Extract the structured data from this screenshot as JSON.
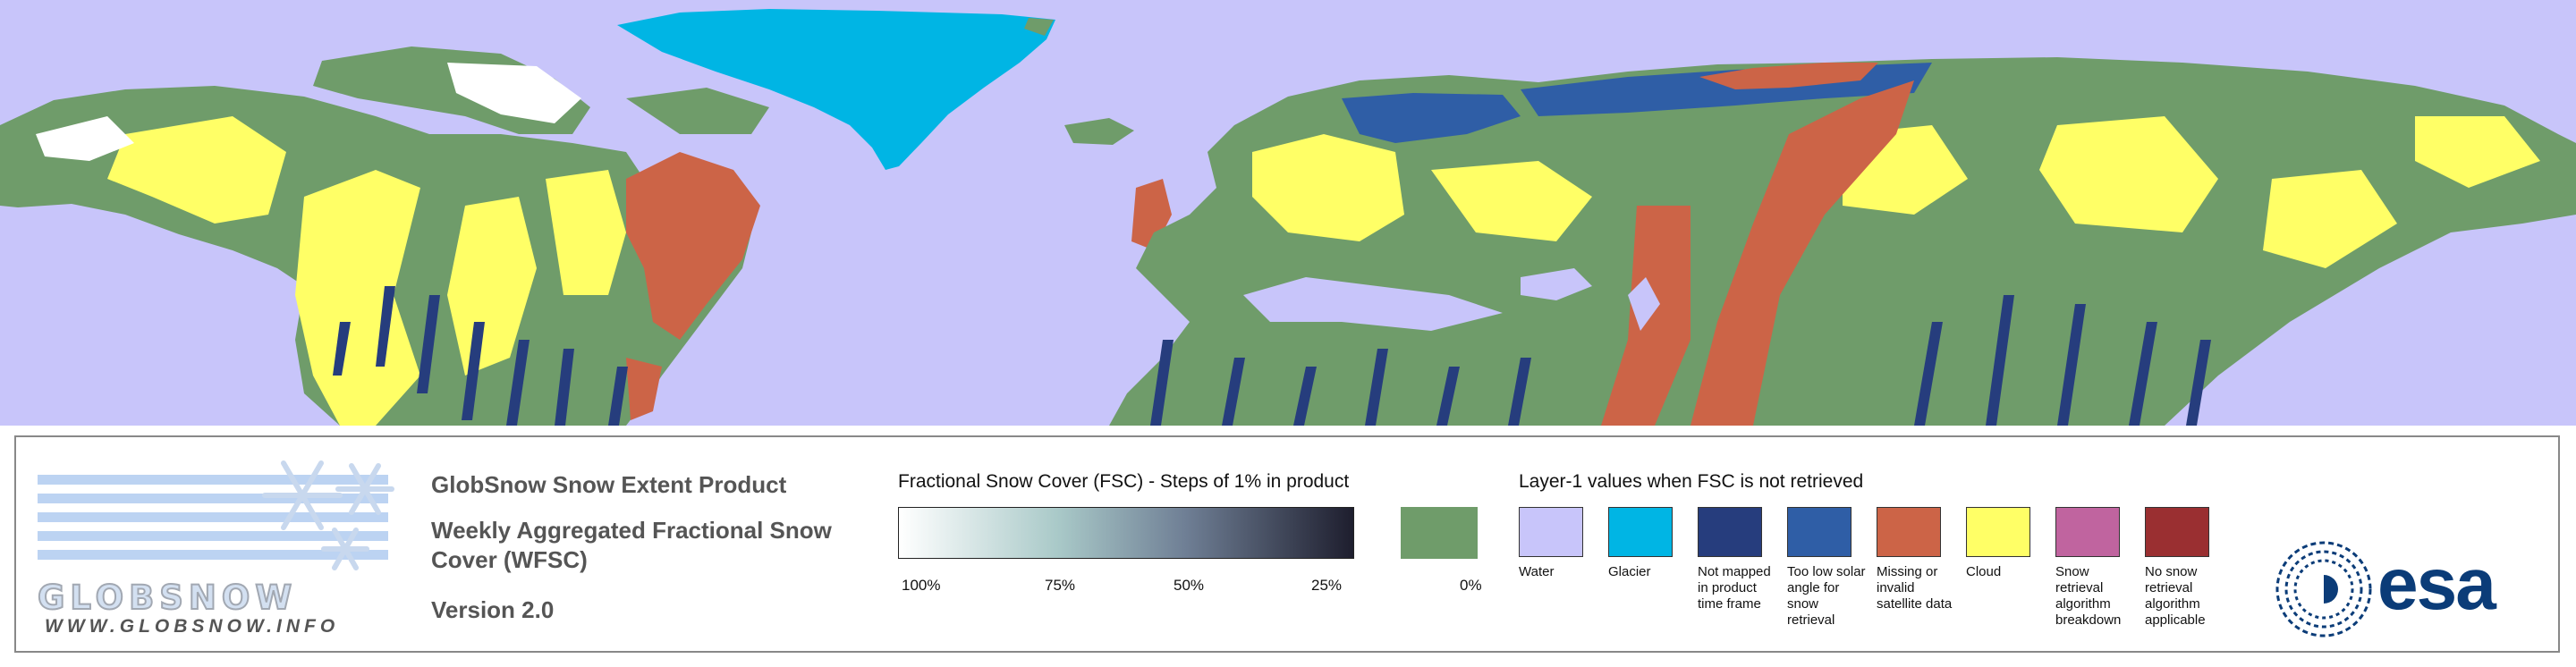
{
  "map": {
    "background_color": "#c8c5fa",
    "colors": {
      "water": "#c8c5fa",
      "glacier": "#00b5e4",
      "not_mapped": "#263d7d",
      "too_low_solar": "#2f5ea6",
      "missing": "#cc6447",
      "cloud": "#ffff66",
      "snow_free": "#6f9c6a"
    }
  },
  "logo": {
    "wordmark": "GLOBSNOW",
    "url": "WWW.GLOBSNOW.INFO"
  },
  "product": {
    "title": "GlobSnow Snow Extent Product",
    "subtitle": "Weekly Aggregated Fractional Snow Cover (WFSC)",
    "version": "Version 2.0"
  },
  "fsc_legend": {
    "title": "Fractional Snow Cover (FSC) - Steps of 1% in product",
    "ticks": [
      "100%",
      "75%",
      "50%",
      "25%",
      "0%"
    ]
  },
  "layer1_legend": {
    "title": "Layer-1 values when FSC is not retrieved",
    "items": [
      {
        "label": "Water",
        "color": "#c8c5fa"
      },
      {
        "label": "Glacier",
        "color": "#00b5e4"
      },
      {
        "label": "Not mapped in product time frame",
        "color": "#263d7d"
      },
      {
        "label": "Too low solar angle for snow retrieval",
        "color": "#2f5ea6"
      },
      {
        "label": "Missing or invalid satellite data",
        "color": "#cc6447"
      },
      {
        "label": "Cloud",
        "color": "#ffff66"
      },
      {
        "label": "Snow retrieval algorithm breakdown",
        "color": "#c0649f"
      },
      {
        "label": "No snow retrieval algorithm applicable",
        "color": "#9a2f31"
      }
    ]
  },
  "agency_logo": {
    "text": "esa"
  }
}
